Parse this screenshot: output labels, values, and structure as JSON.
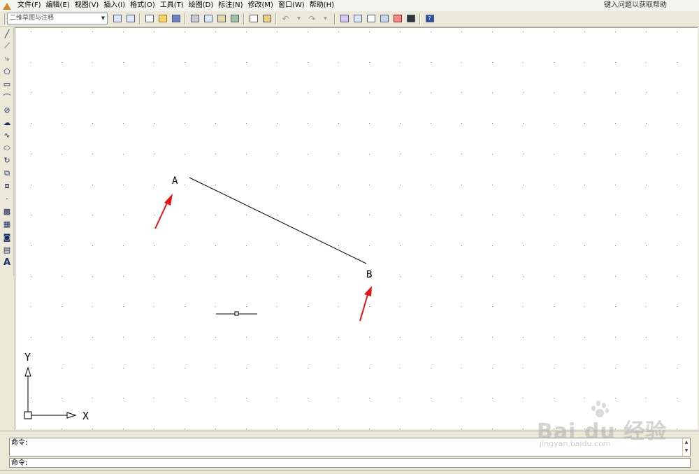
{
  "menubar": {
    "items": [
      "文件(F)",
      "编辑(E)",
      "视图(V)",
      "插入(I)",
      "格式(O)",
      "工具(T)",
      "绘图(D)",
      "标注(N)",
      "修改(M)",
      "窗口(W)",
      "帮助(H)"
    ],
    "help_prompt": "键入问题以获取帮助"
  },
  "toolbar": {
    "workspace_value": "二维草图与注释"
  },
  "drawing": {
    "point_a_label": "A",
    "point_b_label": "B",
    "ucs_y_label": "Y",
    "ucs_x_label": "X",
    "arrow_color": "#ee1111",
    "line_color": "#000000"
  },
  "command": {
    "history_line": "命令:",
    "input_prompt": "命令:"
  },
  "watermark": {
    "brand": "Bai du 经验",
    "url": "jingyan.baidu.com"
  }
}
